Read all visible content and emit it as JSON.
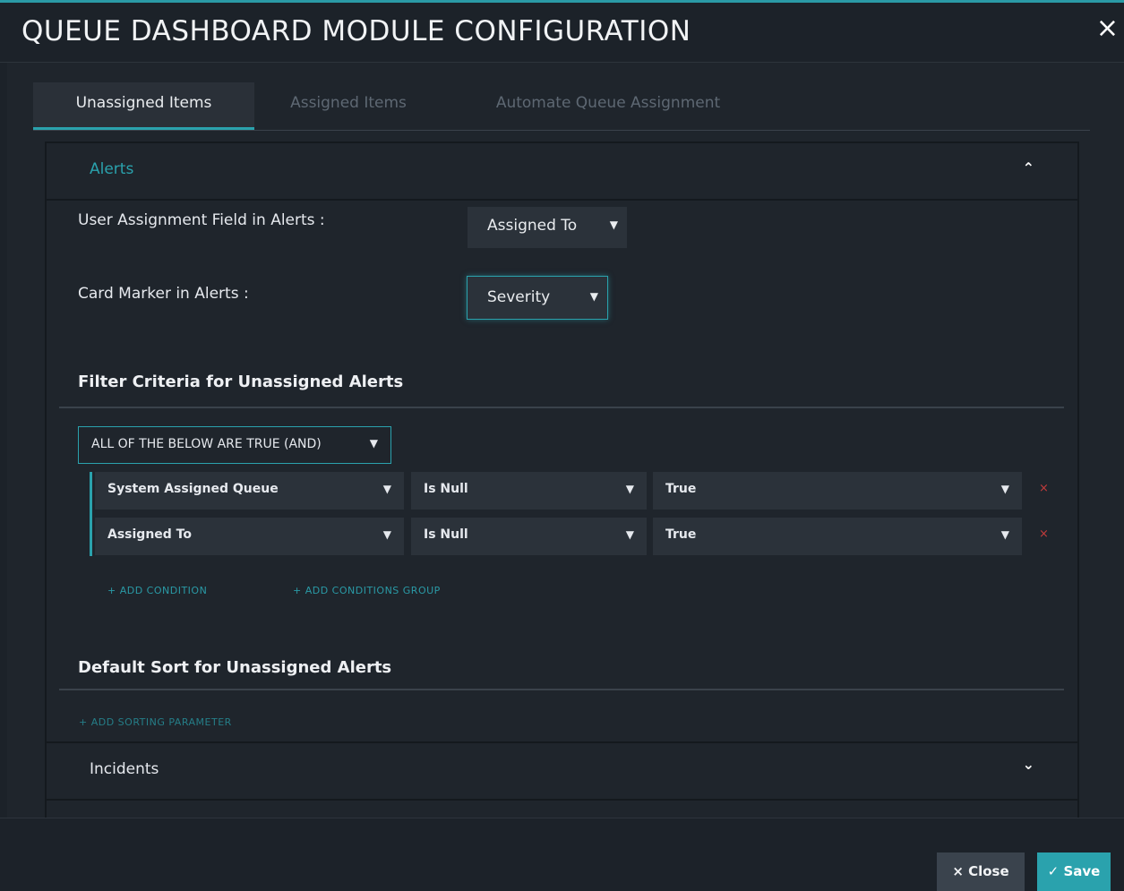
{
  "modal": {
    "title": "QUEUE DASHBOARD MODULE CONFIGURATION",
    "close_icon": "×"
  },
  "tabs": [
    {
      "label": "Unassigned Items",
      "active": true
    },
    {
      "label": "Assigned Items",
      "active": false
    },
    {
      "label": "Automate Queue Assignment",
      "active": false
    }
  ],
  "alerts_section": {
    "title": "Alerts",
    "chevron": "⌃",
    "user_assignment_label": "User Assignment Field in Alerts :",
    "user_assignment_value": "Assigned To",
    "card_marker_label": "Card Marker in Alerts :",
    "card_marker_value": "Severity",
    "filter_heading": "Filter Criteria for Unassigned Alerts",
    "logic_operator": "ALL OF THE BELOW ARE TRUE (AND)",
    "conditions": [
      {
        "field": "System Assigned Queue",
        "operator": "Is Null",
        "value": "True",
        "remove": "×"
      },
      {
        "field": "Assigned To",
        "operator": "Is Null",
        "value": "True",
        "remove": "×"
      }
    ],
    "add_condition": "+ ADD CONDITION",
    "add_conditions_group": "+ ADD CONDITIONS GROUP",
    "sort_heading": "Default Sort for Unassigned Alerts",
    "add_sorting_parameter": "+ ADD SORTING PARAMETER"
  },
  "incidents_section": {
    "title": "Incidents",
    "chevron": "⌄"
  },
  "footer": {
    "close_label": "× Close",
    "save_label": "✓ Save"
  },
  "colors": {
    "accent": "#2aa2ad",
    "background": "#1f252c",
    "danger": "#c23b3b"
  }
}
